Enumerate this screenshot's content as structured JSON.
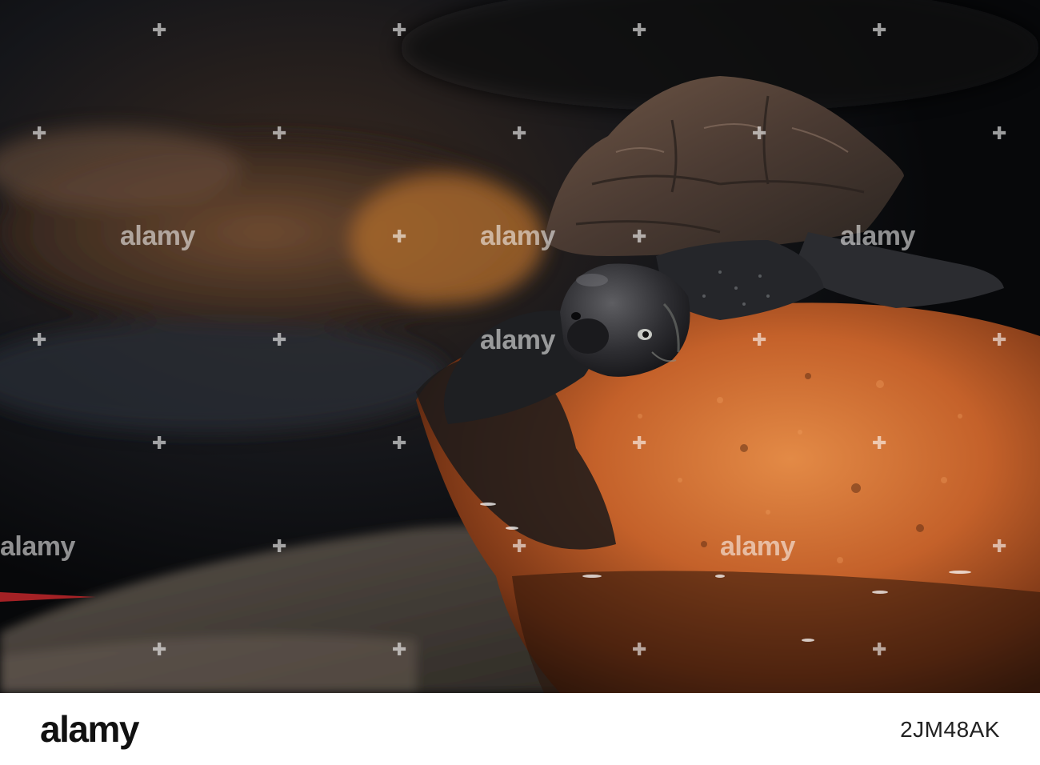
{
  "watermark": {
    "text": "alamy",
    "colors": {
      "overlay": "#ffffff"
    }
  },
  "footer": {
    "logo_text": "alamy",
    "image_id": "2JM48AK"
  },
  "colors": {
    "background": "#0d0f12",
    "rock": "#c8672e",
    "shell": "#5b4a3e",
    "footer_bg": "#ffffff"
  }
}
